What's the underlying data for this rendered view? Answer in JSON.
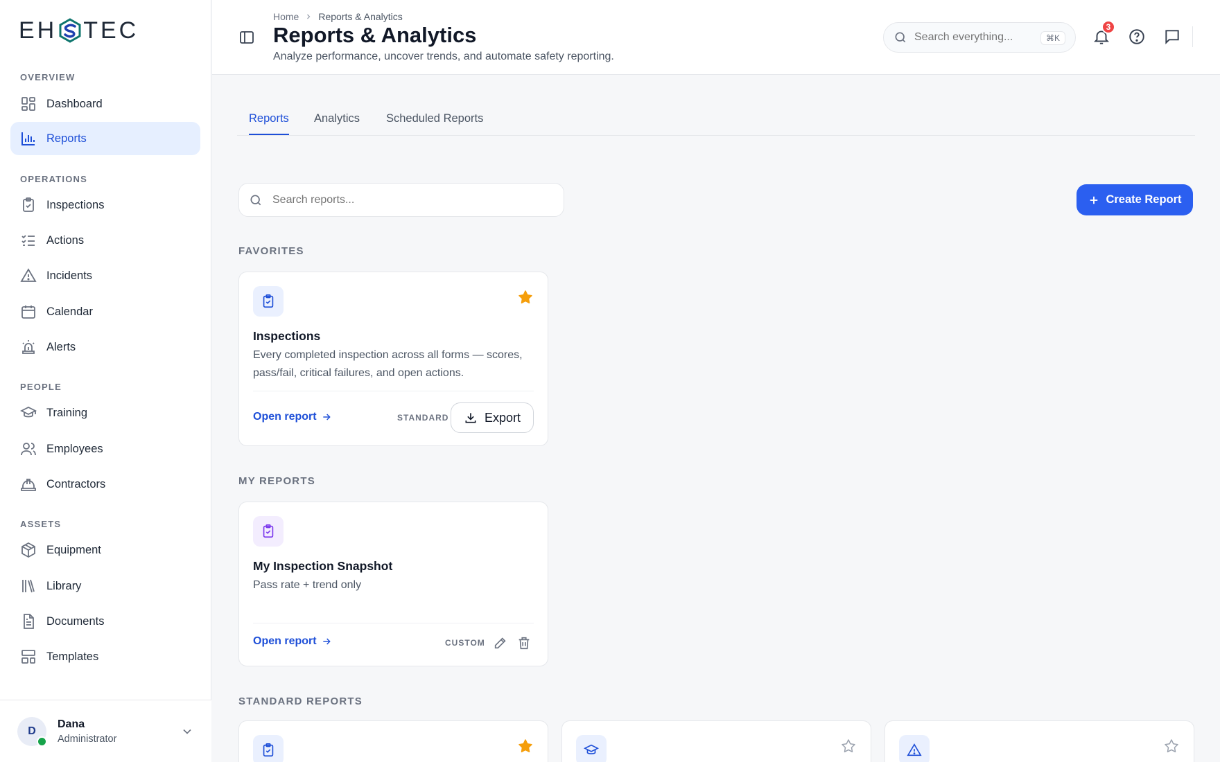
{
  "brand": {
    "logo_left": "EH",
    "logo_right": "TEC"
  },
  "sidebar": {
    "sections": {
      "overview": "OVERVIEW",
      "operations": "OPERATIONS",
      "people": "PEOPLE",
      "assets": "ASSETS"
    },
    "items": [
      {
        "label": "Dashboard",
        "icon": "dashboard-icon"
      },
      {
        "label": "Reports",
        "icon": "bar-chart-icon",
        "active": true
      },
      {
        "label": "Inspections",
        "icon": "clipboard-check-icon"
      },
      {
        "label": "Actions",
        "icon": "checklist-icon"
      },
      {
        "label": "Incidents",
        "icon": "warning-icon"
      },
      {
        "label": "Calendar",
        "icon": "calendar-icon"
      },
      {
        "label": "Alerts",
        "icon": "siren-icon"
      },
      {
        "label": "Training",
        "icon": "graduation-cap-icon"
      },
      {
        "label": "Employees",
        "icon": "users-icon"
      },
      {
        "label": "Contractors",
        "icon": "hard-hat-icon"
      },
      {
        "label": "Equipment",
        "icon": "package-icon"
      },
      {
        "label": "Library",
        "icon": "library-icon"
      },
      {
        "label": "Documents",
        "icon": "document-icon"
      },
      {
        "label": "Templates",
        "icon": "template-icon"
      }
    ],
    "user": {
      "initial": "D",
      "name": "Dana",
      "role": "Administrator",
      "status_color": "#16a34a"
    }
  },
  "header": {
    "breadcrumb": [
      "Home",
      "Reports & Analytics"
    ],
    "title": "Reports & Analytics",
    "subtitle": "Analyze performance, uncover trends, and automate safety reporting.",
    "search_placeholder": "Search everything...",
    "search_shortcut": "⌘K",
    "notification_count": "3"
  },
  "tabs": [
    {
      "label": "Reports",
      "active": true
    },
    {
      "label": "Analytics"
    },
    {
      "label": "Scheduled Reports"
    }
  ],
  "reports": {
    "search_placeholder": "Search reports...",
    "create_label": "Create Report",
    "favorites_label": "FAVORITES",
    "my_reports_label": "MY REPORTS",
    "standard_label": "STANDARD REPORTS",
    "favorite_card": {
      "title": "Inspections",
      "description": "Every completed inspection across all forms — scores, pass/fail, critical failures, and open actions.",
      "open_label": "Open report",
      "kind": "STANDARD",
      "export_label": "Export",
      "starred": true
    },
    "my_card": {
      "title": "My Inspection Snapshot",
      "description": "Pass rate + trend only",
      "open_label": "Open report",
      "kind": "CUSTOM"
    }
  },
  "colors": {
    "accent": "#2b5ff0",
    "star_active": "#f59e0b",
    "badge": "#ef4444"
  }
}
